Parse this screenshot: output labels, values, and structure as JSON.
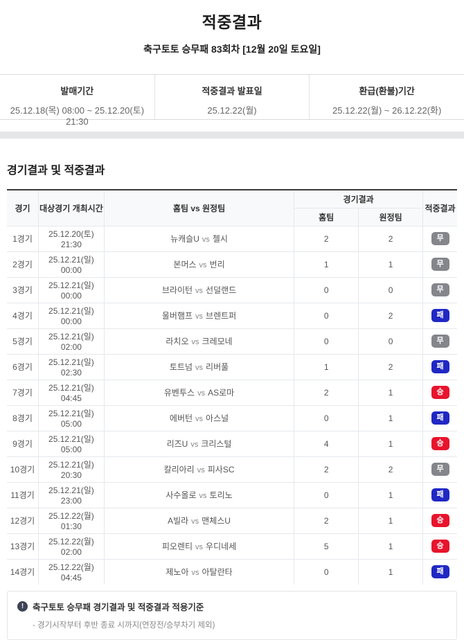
{
  "page": {
    "title": "적중결과",
    "subtitle": "축구토토 승무패 83회차 [12월 20일 토요일]"
  },
  "info_bar": {
    "items": [
      {
        "label": "발매기간",
        "value": "25.12.18(목) 08:00 ~ 25.12.20(토) 21:30"
      },
      {
        "label": "적중결과 발표일",
        "value": "25.12.22(월)"
      },
      {
        "label": "환급(환불)기간",
        "value": "25.12.22(월) ~ 26.12.22(화)"
      }
    ]
  },
  "section": {
    "title": "경기결과 및 적중결과"
  },
  "table": {
    "headers": {
      "game": "경기",
      "time": "대상경기 개최시간",
      "teams": "홈팀 vs 원정팀",
      "match_result": "경기결과",
      "home": "홈팀",
      "away": "원정팀",
      "hit_result": "적중결과"
    },
    "vs_label": "vs",
    "rows": [
      {
        "no": "1경기",
        "time": "25.12.20(토) 21:30",
        "home": "뉴캐슬U",
        "away": "첼시",
        "hs": "2",
        "as": "2",
        "result": "무",
        "type": "draw"
      },
      {
        "no": "2경기",
        "time": "25.12.21(일) 00:00",
        "home": "본머스",
        "away": "번리",
        "hs": "1",
        "as": "1",
        "result": "무",
        "type": "draw"
      },
      {
        "no": "3경기",
        "time": "25.12.21(일) 00:00",
        "home": "브라이턴",
        "away": "선덜랜드",
        "hs": "0",
        "as": "0",
        "result": "무",
        "type": "draw"
      },
      {
        "no": "4경기",
        "time": "25.12.21(일) 00:00",
        "home": "울버햄프",
        "away": "브렌트퍼",
        "hs": "0",
        "as": "2",
        "result": "패",
        "type": "lose"
      },
      {
        "no": "5경기",
        "time": "25.12.21(일) 02:00",
        "home": "라치오",
        "away": "크레모네",
        "hs": "0",
        "as": "0",
        "result": "무",
        "type": "draw"
      },
      {
        "no": "6경기",
        "time": "25.12.21(일) 02:30",
        "home": "토트넘",
        "away": "리버풀",
        "hs": "1",
        "as": "2",
        "result": "패",
        "type": "lose"
      },
      {
        "no": "7경기",
        "time": "25.12.21(일) 04:45",
        "home": "유벤투스",
        "away": "AS로마",
        "hs": "2",
        "as": "1",
        "result": "승",
        "type": "win"
      },
      {
        "no": "8경기",
        "time": "25.12.21(일) 05:00",
        "home": "에버턴",
        "away": "아스널",
        "hs": "0",
        "as": "1",
        "result": "패",
        "type": "lose"
      },
      {
        "no": "9경기",
        "time": "25.12.21(일) 05:00",
        "home": "리즈U",
        "away": "크리스털",
        "hs": "4",
        "as": "1",
        "result": "승",
        "type": "win"
      },
      {
        "no": "10경기",
        "time": "25.12.21(일) 20:30",
        "home": "칼리아리",
        "away": "피사SC",
        "hs": "2",
        "as": "2",
        "result": "무",
        "type": "draw"
      },
      {
        "no": "11경기",
        "time": "25.12.21(일) 23:00",
        "home": "사수올로",
        "away": "토리노",
        "hs": "0",
        "as": "1",
        "result": "패",
        "type": "lose"
      },
      {
        "no": "12경기",
        "time": "25.12.22(월) 01:30",
        "home": "A빌라",
        "away": "맨체스U",
        "hs": "2",
        "as": "1",
        "result": "승",
        "type": "win"
      },
      {
        "no": "13경기",
        "time": "25.12.22(월) 02:00",
        "home": "피오렌티",
        "away": "우디네세",
        "hs": "5",
        "as": "1",
        "result": "승",
        "type": "win"
      },
      {
        "no": "14경기",
        "time": "25.12.22(월) 04:45",
        "home": "제노아",
        "away": "아탈란타",
        "hs": "0",
        "as": "1",
        "result": "패",
        "type": "lose"
      }
    ]
  },
  "footnote": {
    "icon": "exclamation-circle",
    "title": "축구토토 승무패 경기결과 및 적중결과 적용기준",
    "note": "- 경기시작부터 후반 종료 시까지(연장전/승부차기 제외)"
  },
  "colors": {
    "win": "#e8132c",
    "draw": "#84868c",
    "lose": "#2028c4"
  }
}
